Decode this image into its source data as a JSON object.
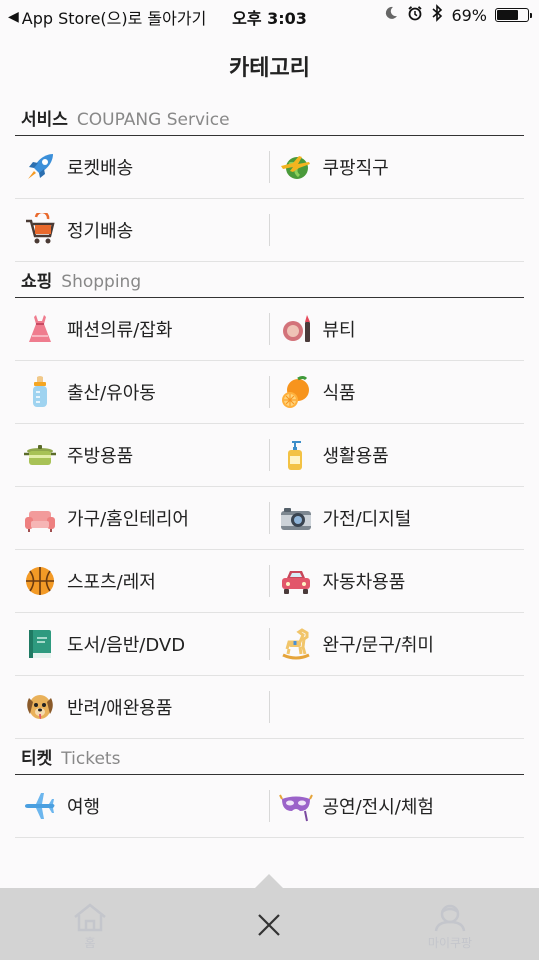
{
  "status_bar": {
    "back_arrow": "◀",
    "back_text": "App Store(으)로 돌아가기",
    "time": "오후 3:03",
    "battery": "69%",
    "battery_level": 0.69
  },
  "page_title": "카테고리",
  "sections": [
    {
      "title_ko": "서비스",
      "title_en": "COUPANG Service",
      "items": [
        {
          "label": "로켓배송",
          "icon": "rocket-icon"
        },
        {
          "label": "쿠팡직구",
          "icon": "globe-plane-icon"
        },
        {
          "label": "정기배송",
          "icon": "cart-icon"
        },
        {
          "label": "",
          "icon": ""
        }
      ]
    },
    {
      "title_ko": "쇼핑",
      "title_en": "Shopping",
      "items": [
        {
          "label": "패션의류/잡화",
          "icon": "dress-icon"
        },
        {
          "label": "뷰티",
          "icon": "cosmetics-icon"
        },
        {
          "label": "출산/유아동",
          "icon": "baby-bottle-icon"
        },
        {
          "label": "식품",
          "icon": "orange-icon"
        },
        {
          "label": "주방용품",
          "icon": "pot-icon"
        },
        {
          "label": "생활용품",
          "icon": "pump-bottle-icon"
        },
        {
          "label": "가구/홈인테리어",
          "icon": "sofa-icon"
        },
        {
          "label": "가전/디지털",
          "icon": "camera-icon"
        },
        {
          "label": "스포츠/레저",
          "icon": "basketball-icon"
        },
        {
          "label": "자동차용품",
          "icon": "car-icon"
        },
        {
          "label": "도서/음반/DVD",
          "icon": "book-icon"
        },
        {
          "label": "완구/문구/취미",
          "icon": "rocking-horse-icon"
        },
        {
          "label": "반려/애완용품",
          "icon": "dog-icon"
        },
        {
          "label": "",
          "icon": ""
        }
      ]
    },
    {
      "title_ko": "티켓",
      "title_en": "Tickets",
      "items": [
        {
          "label": "여행",
          "icon": "airplane-icon"
        },
        {
          "label": "공연/전시/체험",
          "icon": "mask-icon"
        }
      ]
    }
  ],
  "bottom_tabs": {
    "home": "홈",
    "my": "마이쿠팡",
    "close": "close-icon"
  }
}
